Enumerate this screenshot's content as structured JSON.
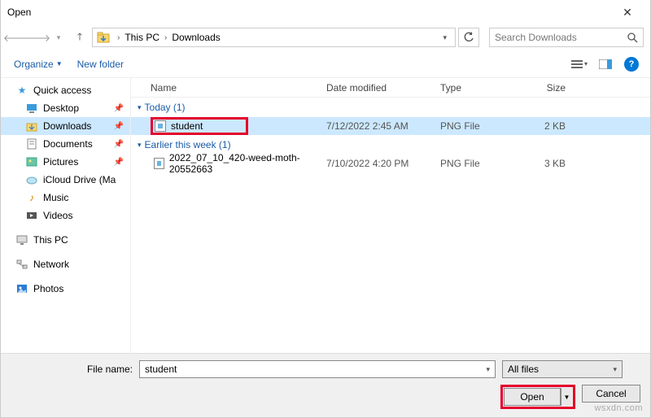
{
  "title": "Open",
  "nav": {
    "path1": "This PC",
    "path2": "Downloads"
  },
  "search": {
    "placeholder": "Search Downloads"
  },
  "toolbar": {
    "organize": "Organize",
    "newfolder": "New folder"
  },
  "columns": {
    "name": "Name",
    "date": "Date modified",
    "type": "Type",
    "size": "Size"
  },
  "sidebar": {
    "quick": "Quick access",
    "desktop": "Desktop",
    "downloads": "Downloads",
    "documents": "Documents",
    "pictures": "Pictures",
    "icloud": "iCloud Drive (Ma",
    "music": "Music",
    "videos": "Videos",
    "thispc": "This PC",
    "network": "Network",
    "photos": "Photos"
  },
  "groups": {
    "g1": {
      "label": "Today (1)"
    },
    "g2": {
      "label": "Earlier this week (1)"
    }
  },
  "files": {
    "f1": {
      "name": "student",
      "date": "7/12/2022 2:45 AM",
      "type": "PNG File",
      "size": "2 KB"
    },
    "f2": {
      "name": "2022_07_10_420-weed-moth-20552663",
      "date": "7/10/2022 4:20 PM",
      "type": "PNG File",
      "size": "3 KB"
    }
  },
  "footer": {
    "filename_label": "File name:",
    "filename_value": "student",
    "filter": "All files",
    "open": "Open",
    "cancel": "Cancel"
  },
  "watermark": "wsxdn.com"
}
